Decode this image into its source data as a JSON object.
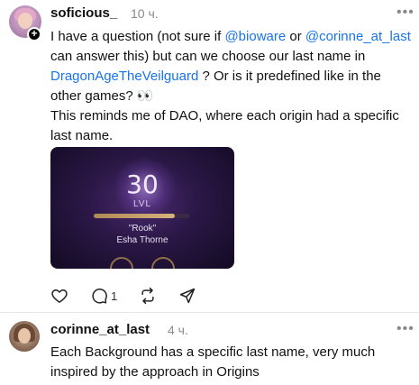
{
  "post": {
    "username": "soficious_",
    "time": "10 ч.",
    "more": "•••",
    "follow_badge": "+",
    "text": {
      "p1": "I have a question (not sure if ",
      "m1": "@bioware",
      "p2": " or ",
      "m2": "@corinne_at_last",
      "p3": " can answer this) but can we choose our last name in ",
      "m3": "DragonAgeTheVeilguard",
      "p4": " ? Or is it predefined like in the other games? 👀",
      "line2": "This reminds me of DAO, where each origin had a specific last name."
    },
    "media": {
      "level": "30",
      "level_label": "LVL",
      "nickname": "\"Rook\"",
      "name": "Esha Thorne",
      "xp_progress_percent": 85
    },
    "actions": {
      "reply_count": "1"
    }
  },
  "reply": {
    "username": "corinne_at_last",
    "time": "4 ч.",
    "text": "Each Background has a specific last name, very much inspired by the approach in Origins",
    "more": "•••"
  },
  "colors": {
    "mention": "#1a73e8",
    "meta": "#8a8a8a"
  }
}
